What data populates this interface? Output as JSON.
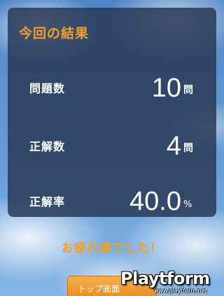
{
  "panel": {
    "title": "今回の結果",
    "rows": [
      {
        "label": "問題数",
        "value": "10",
        "unit": "問"
      },
      {
        "label": "正解数",
        "value": "4",
        "unit": "問"
      },
      {
        "label": "正解率",
        "value": "40.0",
        "unit": "%"
      }
    ]
  },
  "message": "お疲れ様でした！",
  "top_button": {
    "label": "トップ画面"
  },
  "watermark": {
    "brand": "Playtform",
    "url": "www.playtform.net"
  },
  "colors": {
    "accent": "#f0a030",
    "panel_bg": "#2a3a58",
    "button": "#e88a1f"
  }
}
